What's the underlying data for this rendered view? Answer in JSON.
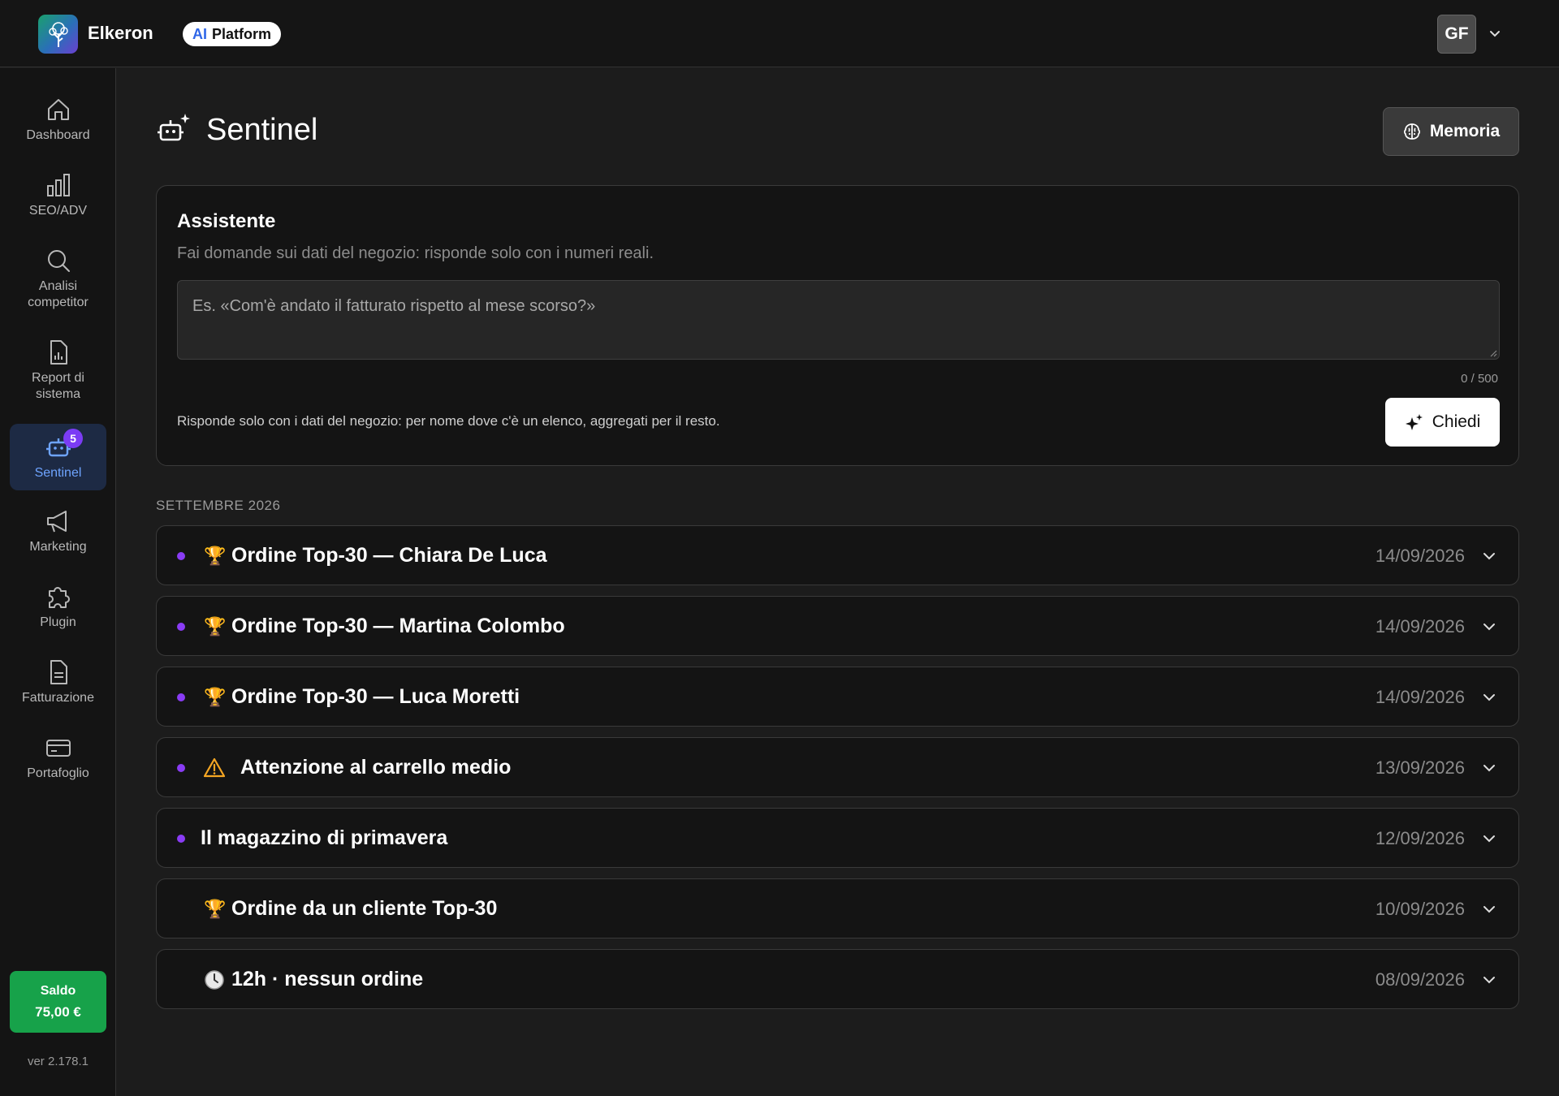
{
  "app": {
    "brand": "Elkeron",
    "platform_ai": "AI",
    "platform_label": "Platform",
    "user_initials": "GF"
  },
  "sidebar": {
    "items": [
      {
        "label": "Dashboard",
        "icon": "home-icon"
      },
      {
        "label": "SEO/ADV",
        "icon": "bar-chart-icon"
      },
      {
        "label": "Analisi competitor",
        "icon": "search-icon"
      },
      {
        "label": "Report di sistema",
        "icon": "report-file-icon"
      },
      {
        "label": "Sentinel",
        "icon": "robot-icon",
        "badge": "5",
        "active": true
      },
      {
        "label": "Marketing",
        "icon": "megaphone-icon"
      },
      {
        "label": "Plugin",
        "icon": "puzzle-icon"
      },
      {
        "label": "Fatturazione",
        "icon": "invoice-icon"
      },
      {
        "label": "Portafoglio",
        "icon": "credit-card-icon"
      }
    ],
    "saldo_label": "Saldo",
    "saldo_amount": "75,00 €",
    "version": "ver 2.178.1"
  },
  "page": {
    "title": "Sentinel",
    "memoria_label": "Memoria"
  },
  "assistant": {
    "title": "Assistente",
    "subtitle": "Fai domande sui dati del negozio: risponde solo con i numeri reali.",
    "placeholder": "Es. «Com'è andato il fatturato rispetto al mese scorso?»",
    "value": "",
    "char_count": "0 / 500",
    "note": "Risponde solo con i dati del negozio: per nome dove c'è un elenco, aggregati per il resto.",
    "ask_label": "Chiedi"
  },
  "section": {
    "label": "SETTEMBRE 2026"
  },
  "notifications": [
    {
      "title": "Ordine Top-30 — Chiara De Luca",
      "date": "14/09/2026",
      "icon": "trophy-icon",
      "unread": true
    },
    {
      "title": "Ordine Top-30 — Martina Colombo",
      "date": "14/09/2026",
      "icon": "trophy-icon",
      "unread": true
    },
    {
      "title": "Ordine Top-30 — Luca Moretti",
      "date": "14/09/2026",
      "icon": "trophy-icon",
      "unread": true
    },
    {
      "title": "Attenzione al carrello medio",
      "date": "13/09/2026",
      "icon": "warning-icon",
      "unread": true
    },
    {
      "title": "Il magazzino di primavera",
      "date": "12/09/2026",
      "icon": "",
      "unread": true
    },
    {
      "title": "Ordine da un cliente Top-30",
      "date": "10/09/2026",
      "icon": "trophy-icon",
      "unread": false
    },
    {
      "title": "12h · nessun ordine",
      "date": "08/09/2026",
      "icon": "clock-icon",
      "unread": false
    }
  ],
  "colors": {
    "accent_purple": "#8a3cf5",
    "active_blue": "#6ea4ff",
    "saldo_green": "#17a24a",
    "background": "#1c1c1c"
  }
}
